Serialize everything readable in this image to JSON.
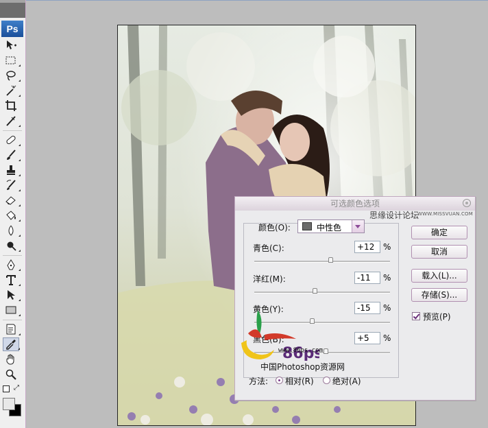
{
  "app": {
    "logo": "Ps"
  },
  "toolbar": {
    "tools": [
      "move-icon",
      "marquee-icon",
      "lasso-icon",
      "magic-wand-icon",
      "crop-icon",
      "slice-icon",
      "healing-brush-icon",
      "brush-icon",
      "clone-stamp-icon",
      "history-brush-icon",
      "eraser-icon",
      "paint-bucket-icon",
      "blur-icon",
      "dodge-icon",
      "pen-icon",
      "type-icon",
      "path-selection-icon",
      "rectangle-icon",
      "notes-icon",
      "eyedropper-icon",
      "hand-icon",
      "zoom-icon"
    ]
  },
  "dialog": {
    "title": "可选颜色选项",
    "watermark": "思缘设计论坛",
    "watermark_url": "WWW.MISSVUAN.COM",
    "colors_label": "颜色(O):",
    "colors_value": "中性色",
    "sliders": [
      {
        "label": "青色(C):",
        "value": "+12",
        "unit": "%",
        "level": 0.56
      },
      {
        "label": "洋红(M):",
        "value": "-11",
        "unit": "%",
        "level": 0.445
      },
      {
        "label": "黄色(Y):",
        "value": "-15",
        "unit": "%",
        "level": 0.425
      },
      {
        "label": "黑色(B):",
        "value": "+5",
        "unit": "%",
        "level": 0.525
      }
    ],
    "method_label": "方法:",
    "method_options": [
      "相对(R)",
      "绝对(A)"
    ],
    "buttons": {
      "ok": "确定",
      "cancel": "取消",
      "load": "载入(L)...",
      "save": "存储(S)..."
    },
    "preview_label": "预览(P)"
  },
  "logo": {
    "brand": "86ps",
    "url": "www.86ps.com",
    "name": "中国Photoshop资源网"
  }
}
